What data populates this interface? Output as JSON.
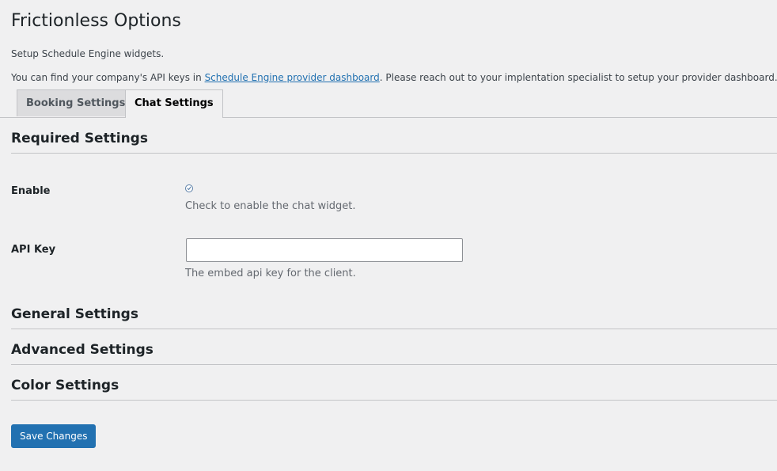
{
  "page": {
    "title": "Frictionless Options",
    "intro_line1": "Setup Schedule Engine widgets.",
    "intro_line2_before": "You can find your company's API keys in ",
    "intro_line2_link": "Schedule Engine provider dashboard",
    "intro_line2_after": ". Please reach out to your implentation specialist to setup your provider dashboard."
  },
  "tabs": {
    "booking": "Booking Settings",
    "chat": "Chat Settings",
    "active": "chat"
  },
  "required": {
    "heading": "Required Settings",
    "enable_label": "Enable",
    "enable_checked": true,
    "enable_desc": "Check to enable the chat widget.",
    "api_key_label": "API Key",
    "api_key_value": "",
    "api_key_desc": "The embed api key for the client."
  },
  "sections": {
    "general": "General Settings",
    "advanced": "Advanced Settings",
    "color": "Color Settings"
  },
  "actions": {
    "save": "Save Changes"
  },
  "colors": {
    "accent": "#2271b1",
    "background": "#f0f0f1"
  }
}
